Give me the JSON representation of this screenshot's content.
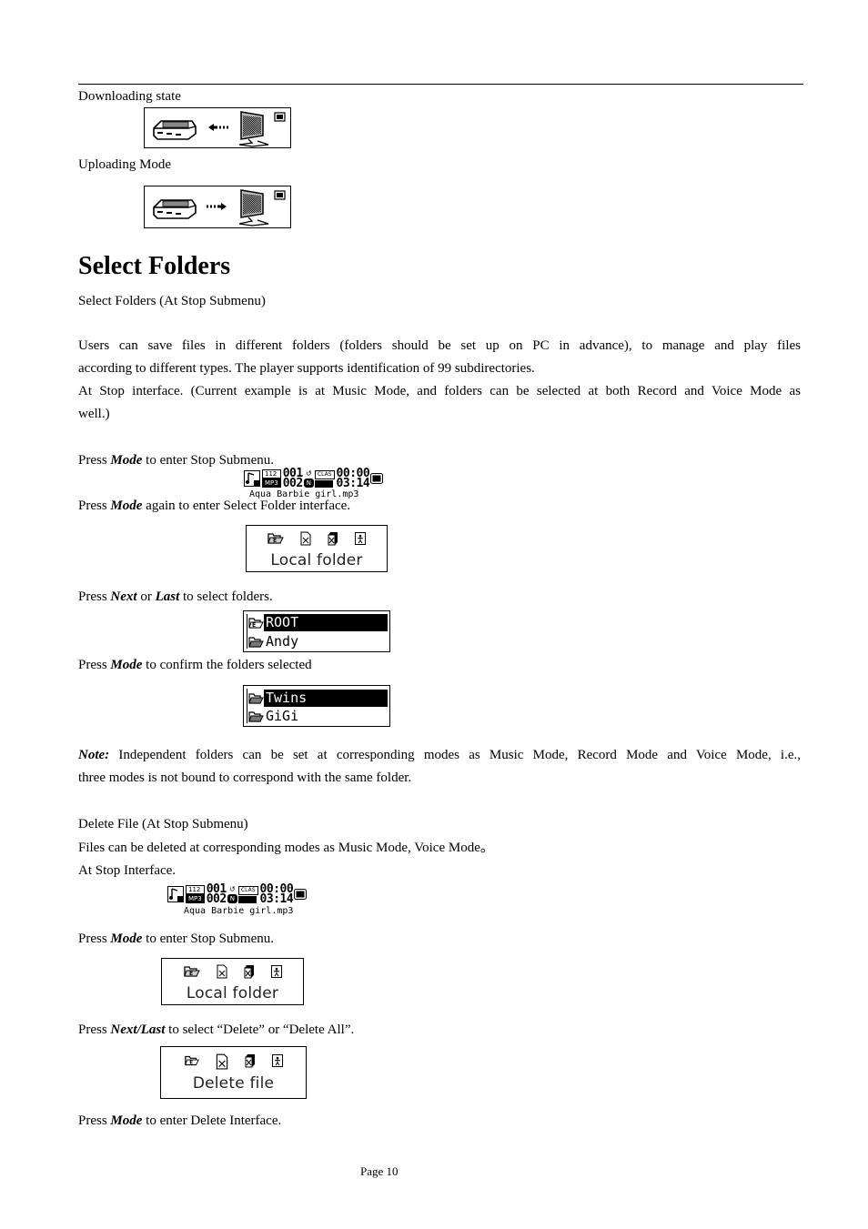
{
  "section_top": {
    "downloading_label": "Downloading state",
    "uploading_label": "Uploading Mode",
    "downloading_icons": [
      "player-device-icon",
      "arrow-left-icon",
      "computer-monitor-icon",
      "battery-icon"
    ],
    "uploading_icons": [
      "player-device-icon",
      "arrow-right-icon",
      "computer-monitor-icon",
      "battery-icon"
    ]
  },
  "heading": "Select Folders",
  "subheading": "Select Folders (At Stop Submenu)",
  "intro": {
    "line1": "Users can save files in different folders (folders should be set up on PC in advance), to manage and play files",
    "line2": "according to different types. The player supports identification of 99 subdirectories.",
    "line3": "At Stop interface. (Current example is at Music Mode, and folders can be selected at both Record and Voice Mode as",
    "line4": "well.)"
  },
  "steps_select": [
    {
      "pre": "Press ",
      "key": "Mode",
      "post": " to enter Stop Submenu."
    },
    {
      "pre": "Press ",
      "key": "Mode",
      "post": " again to enter Select Folder interface."
    },
    {
      "pre": "Press ",
      "key": "Next",
      "mid": " or ",
      "key2": "Last",
      "post": " to select folders."
    },
    {
      "pre": "Press ",
      "key": "Mode",
      "post": " to confirm the folders selected"
    }
  ],
  "stop_screen": {
    "bitrate": "112",
    "format": "MP3",
    "track_current": "001",
    "track_total": "002",
    "eq": "CLAS",
    "time_elapsed": "00:00",
    "time_total": "03:14",
    "repeat_mode": "N",
    "filename": "Aqua Barbie girl.mp3"
  },
  "submenu_screen_1": {
    "icons": [
      "folder-icon",
      "delete-file-icon",
      "delete-all-icon",
      "exit-icon"
    ],
    "label": "Local folder"
  },
  "folder_list_1": {
    "items": [
      {
        "name": "ROOT",
        "selected": true
      },
      {
        "name": "Andy",
        "selected": false
      }
    ]
  },
  "folder_list_2": {
    "items": [
      {
        "name": "Twins",
        "selected": true
      },
      {
        "name": "GiGi",
        "selected": false
      }
    ]
  },
  "note": {
    "label": "Note:",
    "line1": " Independent folders can be set at corresponding modes as Music Mode, Record Mode and Voice Mode, i.e.,",
    "line2": "three modes is not bound to correspond with the same folder."
  },
  "delete_section": {
    "title": "Delete File (At Stop Submenu)",
    "line1": "Files can be deleted at corresponding modes as Music Mode, Voice Mode。",
    "line2": "At Stop Interface."
  },
  "steps_delete": [
    {
      "pre": "Press ",
      "key": "Mode",
      "post": " to enter Stop Submenu."
    },
    {
      "pre": "Press ",
      "key": "Next/Last",
      "post": " to select “Delete” or “Delete All”."
    },
    {
      "pre": "Press ",
      "key": "Mode",
      "post": " to enter Delete Interface."
    }
  ],
  "submenu_screen_2": {
    "icons": [
      "folder-icon",
      "delete-file-icon",
      "delete-all-icon",
      "exit-icon"
    ],
    "label": "Local folder"
  },
  "submenu_screen_3": {
    "icons": [
      "folder-icon",
      "delete-file-icon",
      "delete-all-icon",
      "exit-icon"
    ],
    "label": "Delete file"
  },
  "footer": {
    "page": "Page 10"
  }
}
